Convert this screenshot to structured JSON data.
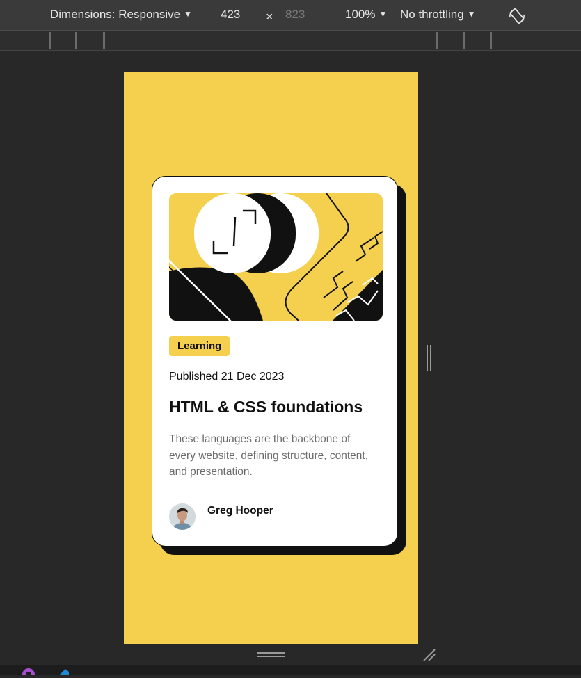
{
  "toolbar": {
    "dimensions_label": "Dimensions: Responsive",
    "width_value": "423",
    "times_symbol": "×",
    "height_value": "823",
    "zoom_label": "100%",
    "throttling_label": "No throttling",
    "caret": "▼"
  },
  "card": {
    "tag_label": "Learning",
    "published": "Published 21 Dec 2023",
    "title": "HTML & CSS foundations",
    "description": "These languages are the backbone of every website, defining structure, content, and presentation.",
    "author_name": "Greg Hooper"
  },
  "colors": {
    "accent_yellow": "#f4d04e",
    "ink": "#111111",
    "devtools_bg": "#282828"
  },
  "icons": {
    "rotate": "rotate-device-icon",
    "side_resize": "resize-handle-icon",
    "corner_resize": "corner-resize-icon"
  }
}
